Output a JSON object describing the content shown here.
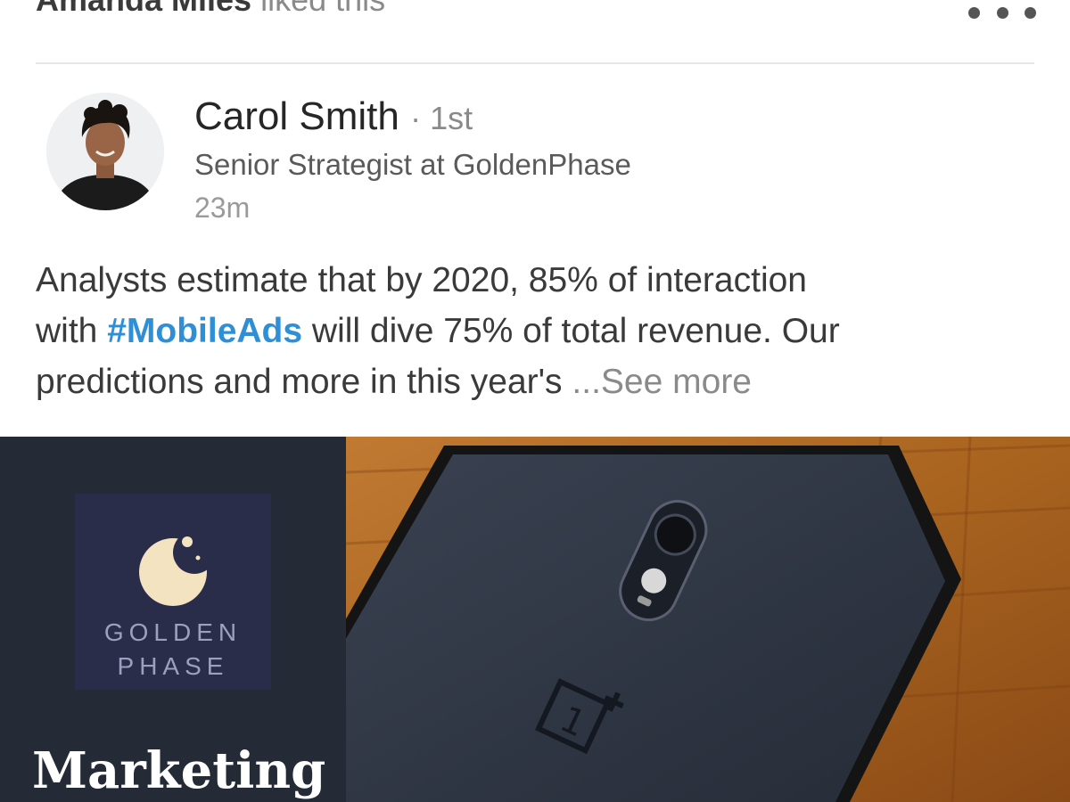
{
  "social_header": {
    "actor": "Amanda Miles",
    "action": "liked this",
    "more_label": "More options"
  },
  "post": {
    "author": {
      "name": "Carol Smith",
      "degree": "· 1st",
      "headline": "Senior Strategist at GoldenPhase",
      "time": "23m"
    },
    "body": {
      "line1": "Analysts estimate that by 2020, 85% of interaction",
      "line2_prefix": "with ",
      "hashtag": "#MobileAds",
      "line2_suffix": " will dive 75% of total revenue. Our",
      "line3": "predictions and more in this year's ",
      "see_more": "...See more"
    },
    "media": {
      "brand_line1": "GOLDEN",
      "brand_line2": "PHASE",
      "title": "Marketing"
    }
  },
  "colors": {
    "hashtag": "#2f8fd6",
    "media_panel": "#252a37",
    "brand_box": "#2a2d4a",
    "wood": "#b8742e",
    "phone": "#333b49"
  }
}
